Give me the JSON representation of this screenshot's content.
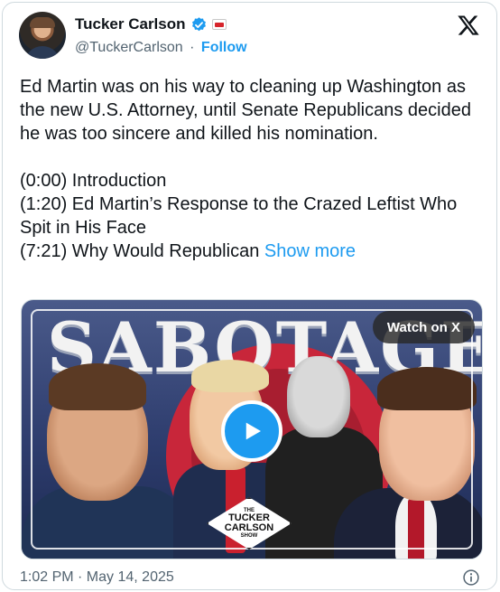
{
  "header": {
    "name": "Tucker Carlson",
    "handle": "@TuckerCarlson",
    "separator": "·",
    "follow_label": "Follow"
  },
  "tweet": {
    "paragraph1": "Ed Martin was on his way to cleaning up Washington as the new U.S. Attorney, until Senate Republicans decided he was too sincere and killed his nomination.",
    "chapters": [
      "(0:00) Introduction",
      "(1:20) Ed Martin’s Response to the Crazed Leftist Who Spit in His Face",
      "(7:21) Why Would Republican"
    ],
    "show_more": "Show more"
  },
  "media": {
    "title_text": "SABOTAGE",
    "watch_label": "Watch on X",
    "badge_top": "THE",
    "badge_line1": "TUCKER",
    "badge_line2": "CARLSON",
    "badge_bottom": "SHOW"
  },
  "footer": {
    "timestamp": "1:02 PM · May 14, 2025"
  },
  "colors": {
    "accent": "#1d9bf0",
    "text": "#0f1419",
    "muted": "#536471",
    "border": "#cfd9de"
  },
  "icons": [
    "verified-badge-icon",
    "tv-badge-icon",
    "x-logo-icon",
    "play-icon",
    "info-icon"
  ]
}
